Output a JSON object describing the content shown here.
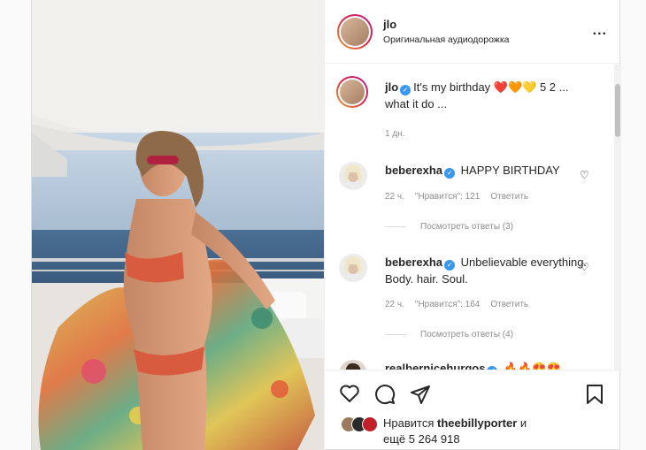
{
  "header": {
    "username": "jlo",
    "subtitle": "Оригинальная аудиодорожка",
    "more_label": "..."
  },
  "caption": {
    "username": "jlo",
    "text": "It's my birthday ❤️🧡💛 5 2 ... what it do ...",
    "time": "1 дн."
  },
  "comments": [
    {
      "username": "beberexha",
      "text": "HAPPY BIRTHDAY",
      "time": "22 ч.",
      "likes": "\"Нравится\": 121",
      "reply": "Ответить",
      "view_replies": "Посмотреть ответы (3)"
    },
    {
      "username": "beberexha",
      "text": "Unbelievable everything. Body. hair. Soul.",
      "time": "22 ч.",
      "likes": "\"Нравится\": 164",
      "reply": "Ответить",
      "view_replies": "Посмотреть ответы (4)"
    },
    {
      "username": "realbernicehurgos",
      "text": "🔥🔥😍😍"
    }
  ],
  "likes": {
    "text": "Нравится",
    "user": "theebillyporter",
    "and": "и",
    "others": "ещё 5 264 918"
  },
  "icons": [
    "heart-icon",
    "comment-icon",
    "share-icon",
    "bookmark-icon",
    "verified-icon",
    "more-icon"
  ],
  "colors": {
    "verified": "#3897f0",
    "gradient_ring": "#dc2743",
    "meta": "#8e8e8e"
  }
}
